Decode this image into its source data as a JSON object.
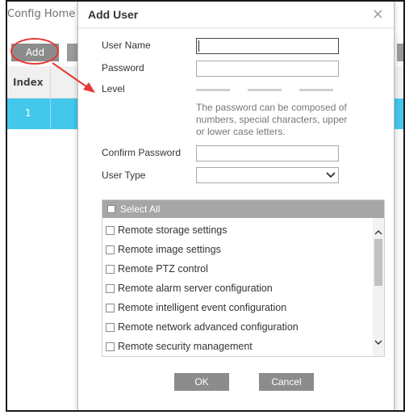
{
  "background": {
    "breadcrumb": "Config Home",
    "add_button": "Add",
    "table": {
      "headers": [
        "Index"
      ],
      "rows": [
        [
          "1"
        ]
      ]
    }
  },
  "dialog": {
    "title": "Add User",
    "close_icon": "close-icon",
    "fields": {
      "user_name_label": "User Name",
      "user_name_value": "",
      "password_label": "Password",
      "password_value": "",
      "level_label": "Level",
      "password_hint": "The password can be composed of numbers, special characters, upper or lower case letters.",
      "confirm_password_label": "Confirm Password",
      "confirm_password_value": "",
      "user_type_label": "User Type",
      "user_type_value": ""
    },
    "permissions": {
      "select_all": "Select All",
      "items": [
        "Remote storage settings",
        "Remote image settings",
        "Remote PTZ control",
        "Remote alarm server configuration",
        "Remote intelligent event configuration",
        "Remote network advanced configuration",
        "Remote security management"
      ]
    },
    "buttons": {
      "ok": "OK",
      "cancel": "Cancel"
    }
  },
  "colors": {
    "annotation": "#e53935",
    "row_selected": "#43c8ec",
    "button_gray": "#8c8c8c"
  }
}
